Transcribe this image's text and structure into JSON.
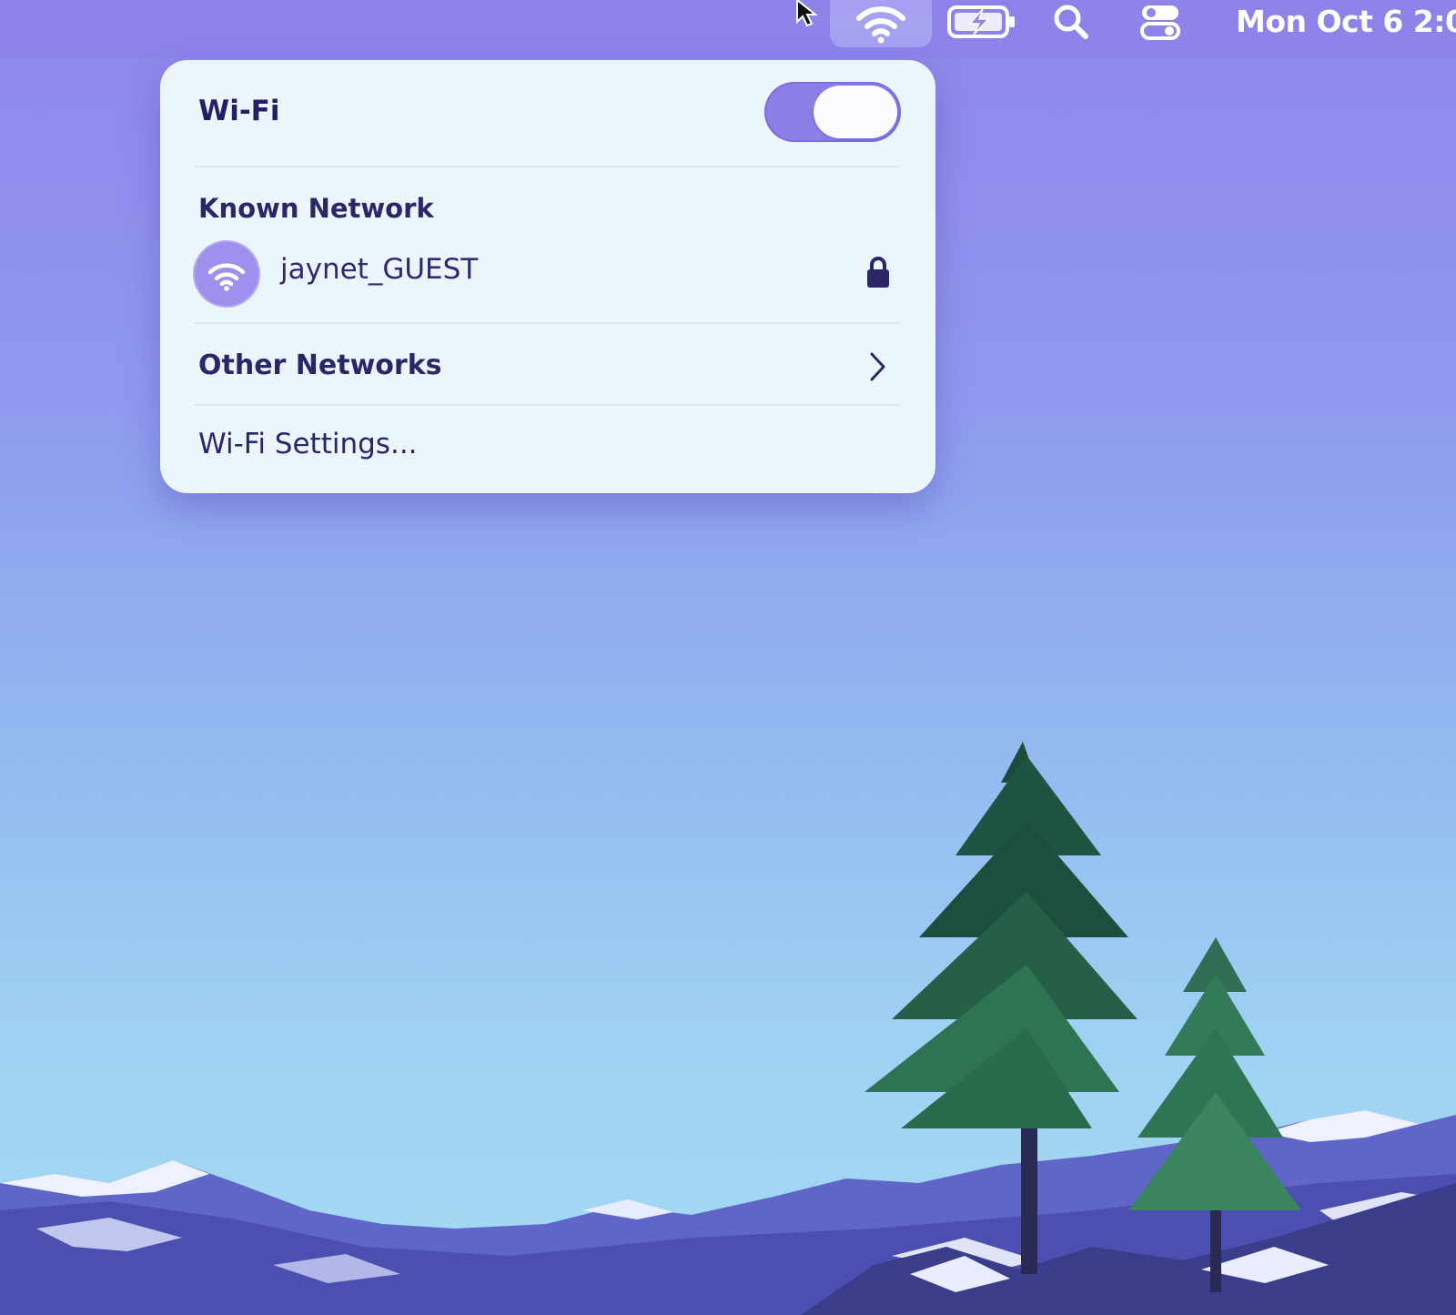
{
  "menubar": {
    "clock": "Mon Oct 6  2:0",
    "icons": [
      "cursor-icon",
      "wifi-icon",
      "battery-charging-icon",
      "search-icon",
      "control-center-icon"
    ]
  },
  "wifi_panel": {
    "title": "Wi-Fi",
    "toggle_on": true,
    "known_section_label": "Known Network",
    "known_network": {
      "name": "jaynet_GUEST",
      "secured": true
    },
    "other_networks_label": "Other Networks",
    "settings_label": "Wi-Fi Settings..."
  },
  "colors": {
    "accent": "#8b7fe6",
    "panel_bg": "#eaf6fb",
    "text": "#2a2668"
  }
}
